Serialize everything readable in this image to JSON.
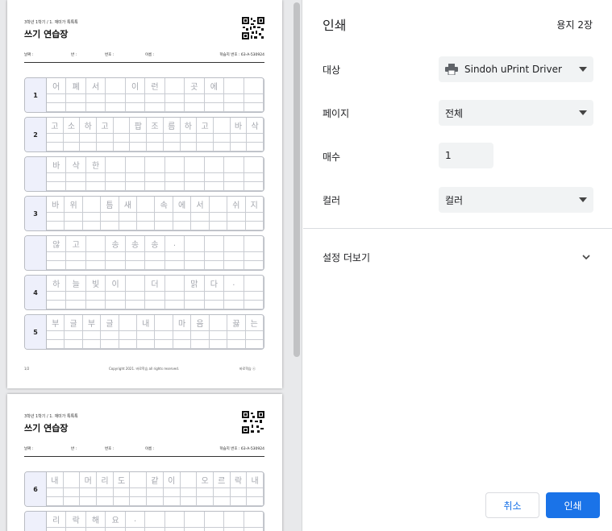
{
  "dialog": {
    "title": "인쇄",
    "sheet_count": "용지 2장",
    "destination_label": "대상",
    "destination_value": "Sindoh uPrint Driver",
    "pages_label": "페이지",
    "pages_value": "전체",
    "copies_label": "매수",
    "copies_value": "1",
    "color_label": "컬러",
    "color_value": "컬러",
    "more_settings": "설정 더보기",
    "cancel_label": "취소",
    "print_label": "인쇄"
  },
  "worksheet": {
    "subtitle": "3학년 1학기 / 1. 재미가 톡톡톡",
    "title": "쓰기 연습장",
    "field_date": "날짜 :",
    "field_class": "반 :",
    "field_number": "번호 :",
    "field_name": "이름 :",
    "sheet_id": "학습지 번호 : 63-A-530924",
    "footer_page": "1/2",
    "footer_copyright": "Copyright 2021. 바로학습 all rights reserved.",
    "footer_brand": "바로학습 ⓔ",
    "rows_page1": [
      {
        "num": "1",
        "chars": [
          "어",
          "폐",
          "서",
          "",
          "이",
          "런",
          "",
          "곳",
          "에",
          "",
          ""
        ]
      },
      {
        "num": "2",
        "chars": [
          "고",
          "소",
          "하",
          "고",
          "",
          "팝",
          "조",
          "름",
          "하",
          "고",
          "",
          "바",
          "삭"
        ]
      },
      {
        "num": "",
        "chars": [
          "바",
          "삭",
          "한",
          "",
          "",
          "",
          "",
          "",
          "",
          "",
          ""
        ]
      },
      {
        "num": "3",
        "chars": [
          "바",
          "위",
          "",
          "틈",
          "새",
          "",
          "속",
          "에",
          "서",
          "",
          "쉬",
          "지"
        ]
      },
      {
        "num": "",
        "chars": [
          "않",
          "고",
          "",
          "송",
          "송",
          "송",
          ".",
          "",
          "",
          "",
          ""
        ]
      },
      {
        "num": "4",
        "chars": [
          "하",
          "늘",
          "빛",
          "이",
          "",
          "더",
          "",
          "맑",
          "다",
          ".",
          ""
        ]
      },
      {
        "num": "5",
        "chars": [
          "부",
          "글",
          "부",
          "글",
          "",
          "내",
          "",
          "마",
          "음",
          "",
          "끓",
          "는"
        ]
      }
    ],
    "rows_page2": [
      {
        "num": "6",
        "chars": [
          "내",
          "",
          "머",
          "리",
          "도",
          "",
          "같",
          "이",
          "",
          "오",
          "르",
          "락",
          "내"
        ]
      },
      {
        "num": "",
        "chars": [
          "리",
          "락",
          "해",
          "요",
          ".",
          "",
          "",
          "",
          "",
          "",
          ""
        ]
      }
    ]
  }
}
